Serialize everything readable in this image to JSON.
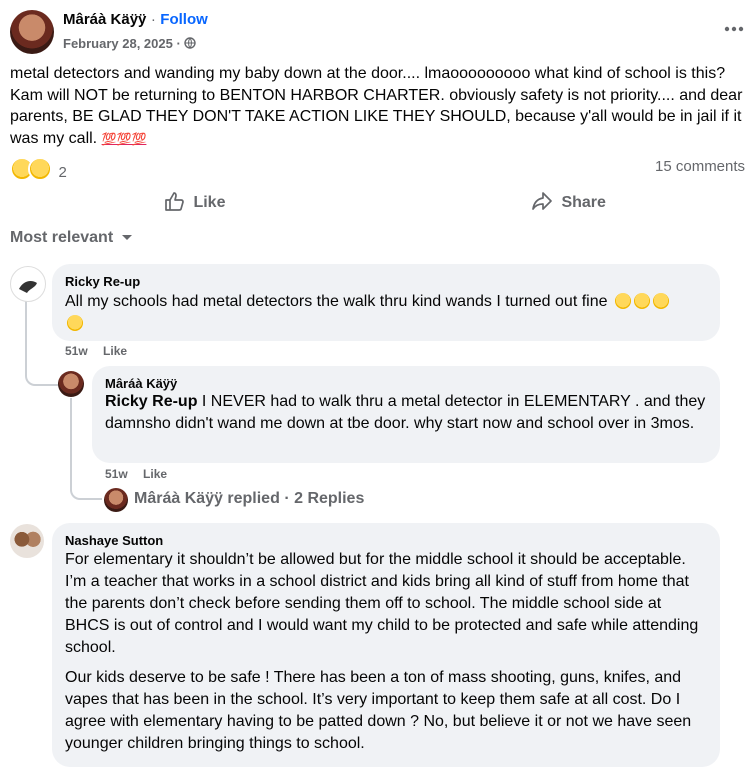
{
  "post": {
    "author": "Mâráà Käÿÿ",
    "follow_label": "Follow",
    "date": "February 28, 2025",
    "separator": "·",
    "text": "metal detectors and wanding my baby down at the door.... lmaooooooooo what kind of school is this? Kam will NOT be returning to BENTON HARBOR CHARTER. obviously safety is not priority.... and dear parents, BE GLAD THEY DON'T TAKE ACTION LIKE THEY SHOULD, because y'all would be in jail if it was my call.",
    "trailing_emoji": "💯💯💯",
    "reaction_count": "2",
    "comments_count": "15 comments",
    "like_label": "Like",
    "share_label": "Share"
  },
  "filter": {
    "label": "Most relevant"
  },
  "comments": [
    {
      "author": "Ricky Re-up",
      "text": "All my schools had metal detectors the walk thru kind wands I turned out fine",
      "time": "51w",
      "like": "Like"
    },
    {
      "author": "Mâráà Käÿÿ",
      "mention": "Ricky Re-up",
      "text": " I NEVER had to walk thru a metal detector in ELEMENTARY . and they damnsho didn't wand me down at tbe door. why start now and school over in 3mos.",
      "time": "51w",
      "like": "Like"
    },
    {
      "replied": "Mâráà Käÿÿ replied",
      "dot": "·",
      "replies": "2 Replies"
    },
    {
      "author": "Nashaye Sutton",
      "para1": "For elementary it shouldn’t be allowed but for the middle school it should be acceptable. I’m a teacher that works in a school district and kids bring all kind of stuff from home that the parents don’t check before sending them off to school. The middle school side at BHCS is out of control and I would want my child to be protected and safe while attending school.",
      "para2": "Our kids deserve to be safe ! There has been a ton of mass shooting, guns, knifes, and vapes that has been in the school. It’s very important to keep them safe at all cost. Do I agree with elementary having to be patted down ? No, but believe it or not we have seen younger children bringing things to school."
    }
  ],
  "colors": {
    "accent": "#0866ff",
    "muted": "#65676b",
    "bubble": "#f0f2f5"
  }
}
